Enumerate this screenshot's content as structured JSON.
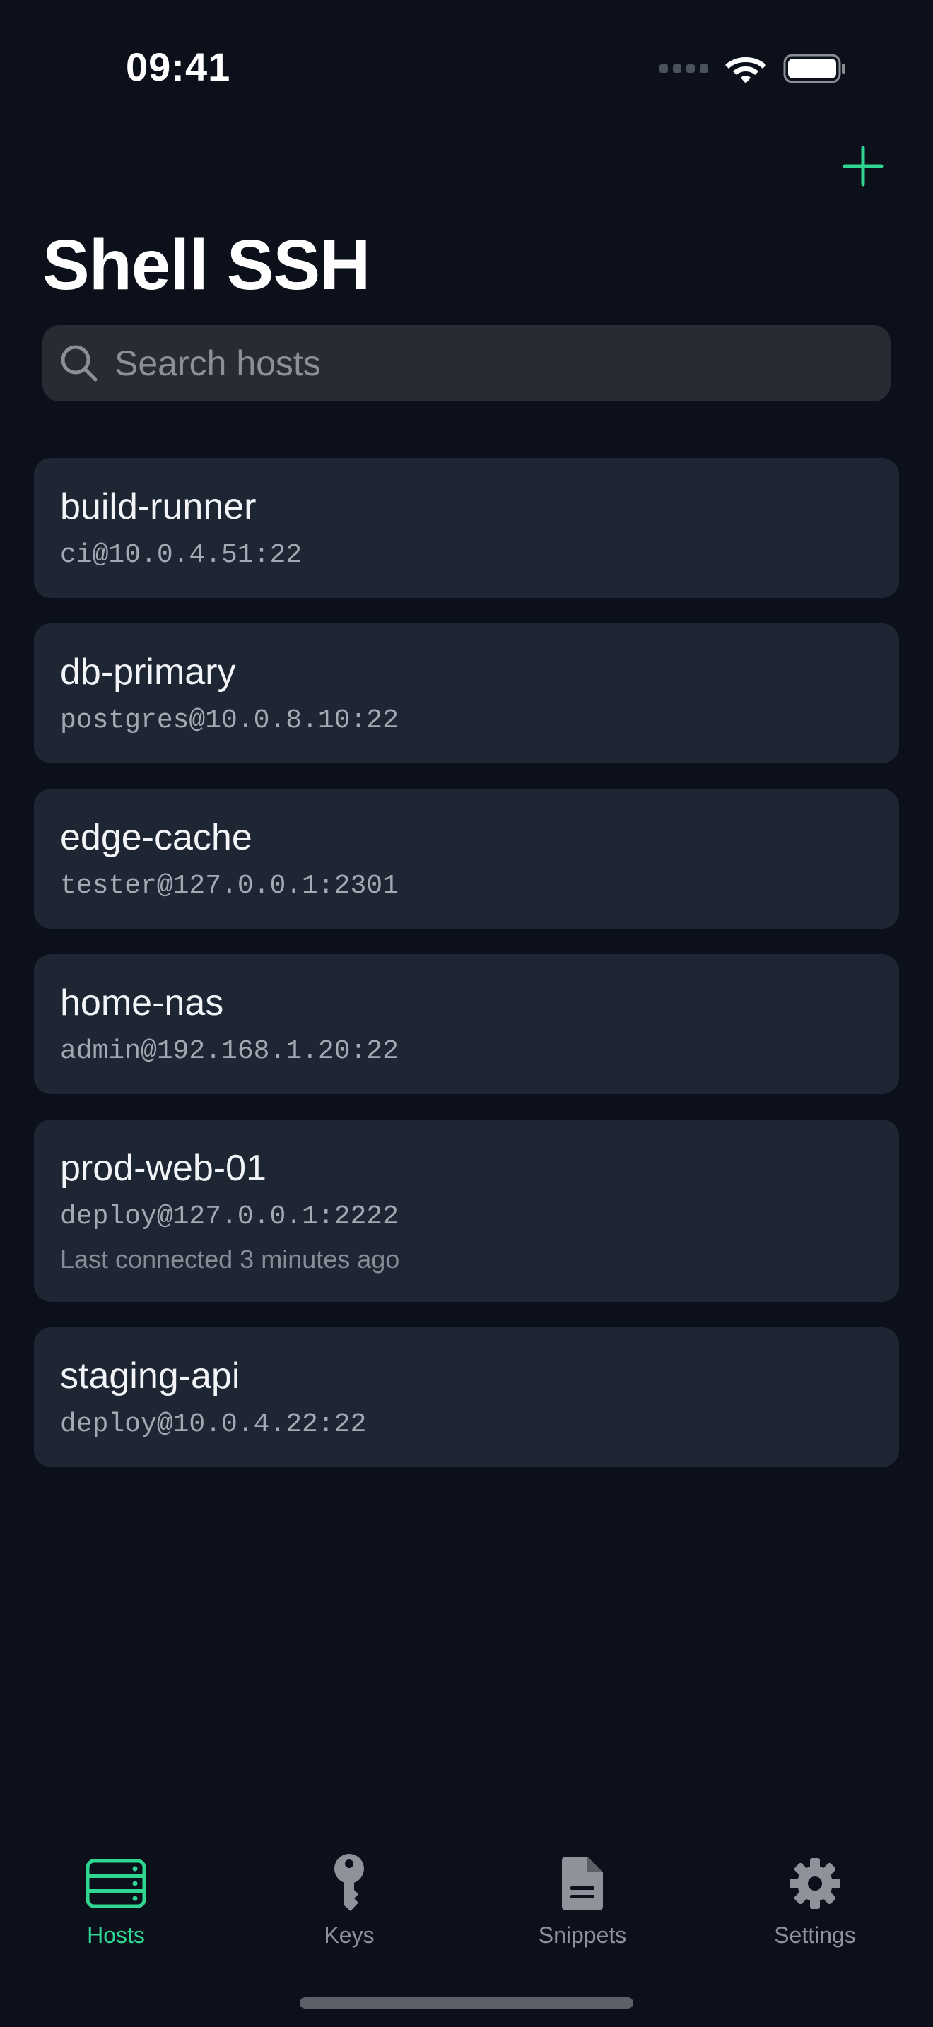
{
  "status_bar": {
    "time": "09:41"
  },
  "header": {
    "title": "Shell SSH",
    "add_icon": "plus-icon"
  },
  "search": {
    "placeholder": "Search hosts",
    "value": ""
  },
  "hosts": [
    {
      "name": "build-runner",
      "address": "ci@10.0.4.51:22"
    },
    {
      "name": "db-primary",
      "address": "postgres@10.0.8.10:22"
    },
    {
      "name": "edge-cache",
      "address": "tester@127.0.0.1:2301"
    },
    {
      "name": "home-nas",
      "address": "admin@192.168.1.20:22"
    },
    {
      "name": "prod-web-01",
      "address": "deploy@127.0.0.1:2222",
      "last_connected": "Last connected 3 minutes ago"
    },
    {
      "name": "staging-api",
      "address": "deploy@10.0.4.22:22"
    }
  ],
  "tabs": [
    {
      "label": "Hosts",
      "icon": "server-icon",
      "active": true
    },
    {
      "label": "Keys",
      "icon": "key-icon",
      "active": false
    },
    {
      "label": "Snippets",
      "icon": "document-icon",
      "active": false
    },
    {
      "label": "Settings",
      "icon": "gear-icon",
      "active": false
    }
  ],
  "colors": {
    "accent": "#2fd691",
    "background": "#0b101a",
    "card": "#1e2533",
    "inactive": "#8e939b"
  }
}
